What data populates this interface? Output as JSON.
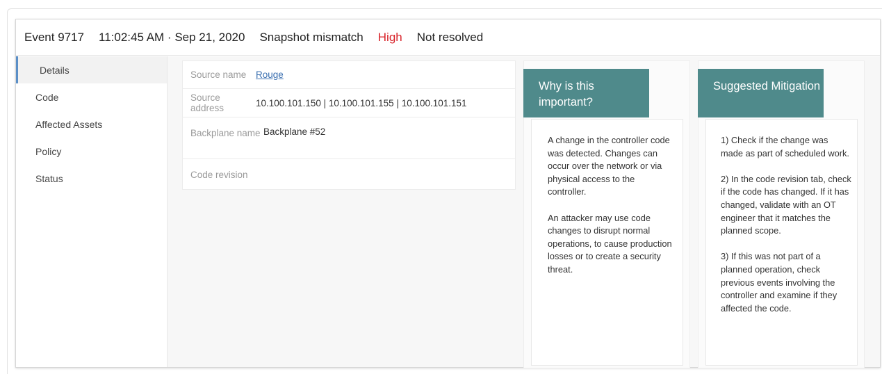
{
  "header": {
    "event_id": "Event 9717",
    "timestamp": "11:02:45 AM · Sep 21, 2020",
    "event_type": "Snapshot mismatch",
    "severity": "High",
    "status": "Not resolved"
  },
  "colors": {
    "severity_high": "#d8232a",
    "card_header": "#4f8a8b",
    "active_nav_accent": "#5b8fc7",
    "link": "#3a6fb0"
  },
  "sidebar": {
    "items": [
      {
        "label": "Details",
        "active": true
      },
      {
        "label": "Code"
      },
      {
        "label": "Affected Assets"
      },
      {
        "label": "Policy"
      },
      {
        "label": "Status"
      }
    ]
  },
  "details": {
    "rows": [
      {
        "label": "Source name",
        "value": "Rouge"
      },
      {
        "label": "Source address",
        "value": "10.100.101.150 | 10.100.101.155 | 10.100.101.151"
      },
      {
        "label": "Backplane name",
        "value": "Backplane #52"
      },
      {
        "label": "Code revision",
        "value": ""
      }
    ]
  },
  "why_important": {
    "title": "Why is this important?",
    "paragraphs": [
      "A change in the controller code was detected. Changes can occur over the network or via physical access to the controller.",
      "An attacker may use code changes to disrupt normal operations, to cause production losses or to create a security threat."
    ]
  },
  "mitigation": {
    "title": "Suggested Mitigation",
    "paragraphs": [
      "1) Check if the change was made as part of scheduled work.",
      "2) In the code revision tab, check if the code has changed. If it has changed, validate with an OT engineer that it matches the planned scope.",
      "3) If this was not part of a planned operation, check previous events involving the controller and examine if they affected the code."
    ]
  }
}
